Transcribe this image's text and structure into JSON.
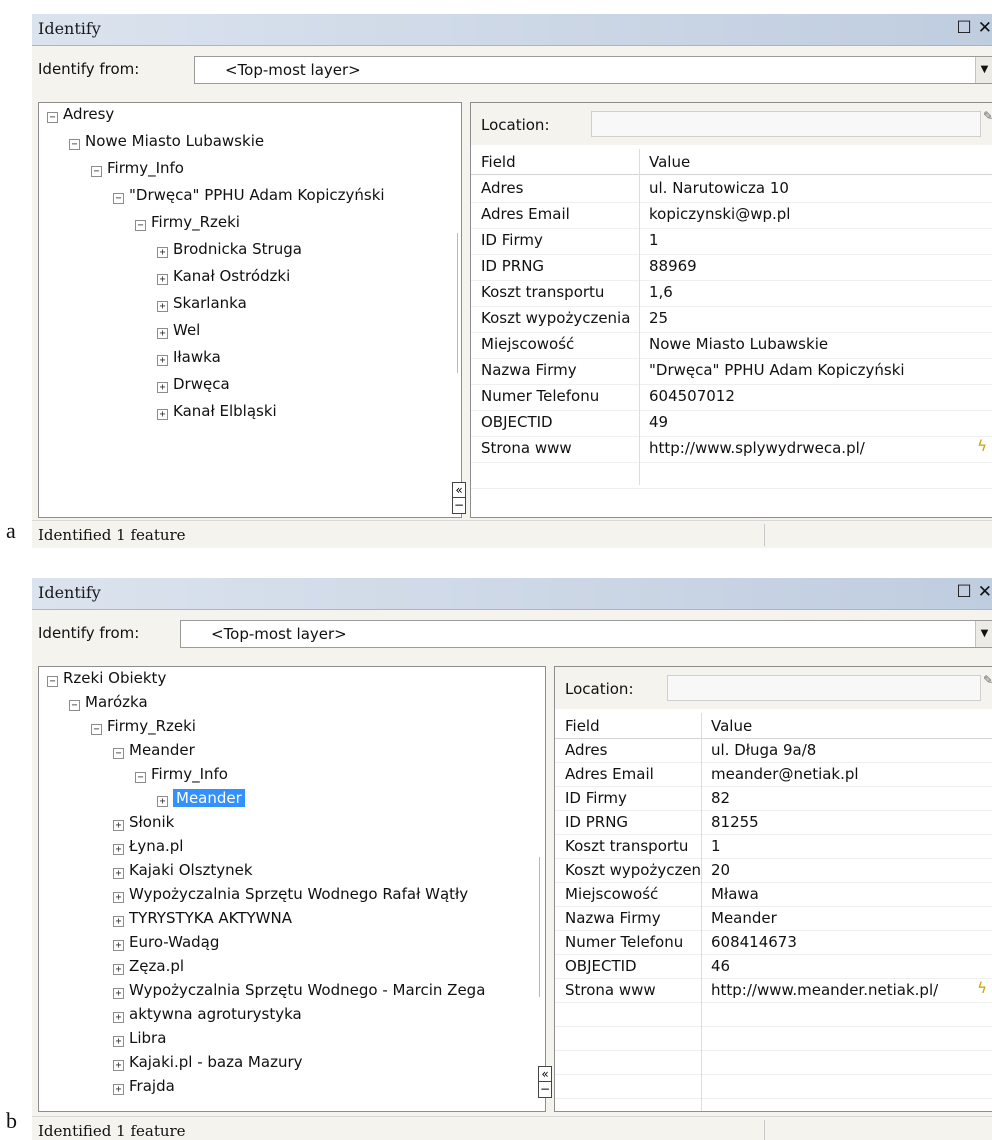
{
  "panels": [
    {
      "figure_label": "a",
      "title": "Identify",
      "window_controls": {
        "maximize": "☐",
        "close": "✕"
      },
      "identify_from_label": "Identify from:",
      "identify_from_value": "<Top-most layer>",
      "tree": [
        {
          "label": "Adresy",
          "level": 0,
          "expander": "−"
        },
        {
          "label": "Nowe Miasto Lubawskie",
          "level": 1,
          "expander": "−"
        },
        {
          "label": "Firmy_Info",
          "level": 2,
          "expander": "−"
        },
        {
          "label": "\"Drwęca\" PPHU Adam Kopiczyński",
          "level": 3,
          "expander": "−"
        },
        {
          "label": "Firmy_Rzeki",
          "level": 4,
          "expander": "−"
        },
        {
          "label": "Brodnicka Struga",
          "level": 5,
          "expander": "+"
        },
        {
          "label": "Kanał Ostródzki",
          "level": 5,
          "expander": "+"
        },
        {
          "label": "Skarlanka",
          "level": 5,
          "expander": "+"
        },
        {
          "label": "Wel",
          "level": 5,
          "expander": "+"
        },
        {
          "label": "Iławka",
          "level": 5,
          "expander": "+"
        },
        {
          "label": "Drwęca",
          "level": 5,
          "expander": "+"
        },
        {
          "label": "Kanał Elbląski",
          "level": 5,
          "expander": "+"
        }
      ],
      "location_label": "Location:",
      "columns": {
        "field": "Field",
        "value": "Value"
      },
      "rows": [
        {
          "field": "Adres",
          "value": "ul. Narutowicza 10"
        },
        {
          "field": "Adres Email",
          "value": "kopiczynski@wp.pl"
        },
        {
          "field": "ID Firmy",
          "value": "1"
        },
        {
          "field": "ID PRNG",
          "value": "88969"
        },
        {
          "field": "Koszt transportu",
          "value": "1,6"
        },
        {
          "field": "Koszt wypożyczenia",
          "value": "25"
        },
        {
          "field": "Miejscowość",
          "value": "Nowe Miasto Lubawskie"
        },
        {
          "field": "Nazwa Firmy",
          "value": "\"Drwęca\" PPHU Adam Kopiczyński"
        },
        {
          "field": "Numer Telefonu",
          "value": "604507012"
        },
        {
          "field": "OBJECTID",
          "value": "49"
        },
        {
          "field": "Strona www",
          "value": "http://www.splywydrweca.pl/"
        }
      ],
      "link_icon": "lightning-hyperlink-icon",
      "splitter_glyph": "«",
      "status": "Identified 1 feature"
    },
    {
      "figure_label": "b",
      "title": "Identify",
      "window_controls": {
        "maximize": "☐",
        "close": "✕"
      },
      "identify_from_label": "Identify from:",
      "identify_from_value": "<Top-most layer>",
      "tree": [
        {
          "label": "Rzeki Obiekty",
          "level": 0,
          "expander": "−"
        },
        {
          "label": "Marózka",
          "level": 1,
          "expander": "−"
        },
        {
          "label": "Firmy_Rzeki",
          "level": 2,
          "expander": "−"
        },
        {
          "label": "Meander",
          "level": 3,
          "expander": "−"
        },
        {
          "label": "Firmy_Info",
          "level": 4,
          "expander": "−"
        },
        {
          "label": "Meander",
          "level": 5,
          "expander": "+",
          "selected": true
        },
        {
          "label": "Słonik",
          "level": 3,
          "expander": "+"
        },
        {
          "label": "Łyna.pl",
          "level": 3,
          "expander": "+"
        },
        {
          "label": "Kajaki Olsztynek",
          "level": 3,
          "expander": "+"
        },
        {
          "label": "Wypożyczalnia Sprzętu Wodnego Rafał Wątły",
          "level": 3,
          "expander": "+"
        },
        {
          "label": "TYRYSTYKA AKTYWNA",
          "level": 3,
          "expander": "+"
        },
        {
          "label": "Euro-Wadąg",
          "level": 3,
          "expander": "+"
        },
        {
          "label": "Zęza.pl",
          "level": 3,
          "expander": "+"
        },
        {
          "label": "Wypożyczalnia Sprzętu Wodnego - Marcin Zega",
          "level": 3,
          "expander": "+"
        },
        {
          "label": "aktywna agroturystyka",
          "level": 3,
          "expander": "+"
        },
        {
          "label": "Libra",
          "level": 3,
          "expander": "+"
        },
        {
          "label": "Kajaki.pl - baza Mazury",
          "level": 3,
          "expander": "+"
        },
        {
          "label": "Frajda",
          "level": 3,
          "expander": "+"
        }
      ],
      "location_label": "Location:",
      "columns": {
        "field": "Field",
        "value": "Value"
      },
      "rows": [
        {
          "field": "Adres",
          "value": "ul. Długa 9a/8"
        },
        {
          "field": "Adres Email",
          "value": "meander@netiak.pl"
        },
        {
          "field": "ID Firmy",
          "value": "82"
        },
        {
          "field": "ID PRNG",
          "value": "81255"
        },
        {
          "field": "Koszt transportu",
          "value": "1"
        },
        {
          "field": "Koszt wypożyczenia",
          "value": "20"
        },
        {
          "field": "Miejscowość",
          "value": "Mława"
        },
        {
          "field": "Nazwa Firmy",
          "value": "Meander"
        },
        {
          "field": "Numer Telefonu",
          "value": "608414673"
        },
        {
          "field": "OBJECTID",
          "value": "46"
        },
        {
          "field": "Strona www",
          "value": "http://www.meander.netiak.pl/"
        }
      ],
      "link_icon": "lightning-hyperlink-icon",
      "splitter_glyph": "«",
      "status": "Identified 1 feature"
    }
  ]
}
